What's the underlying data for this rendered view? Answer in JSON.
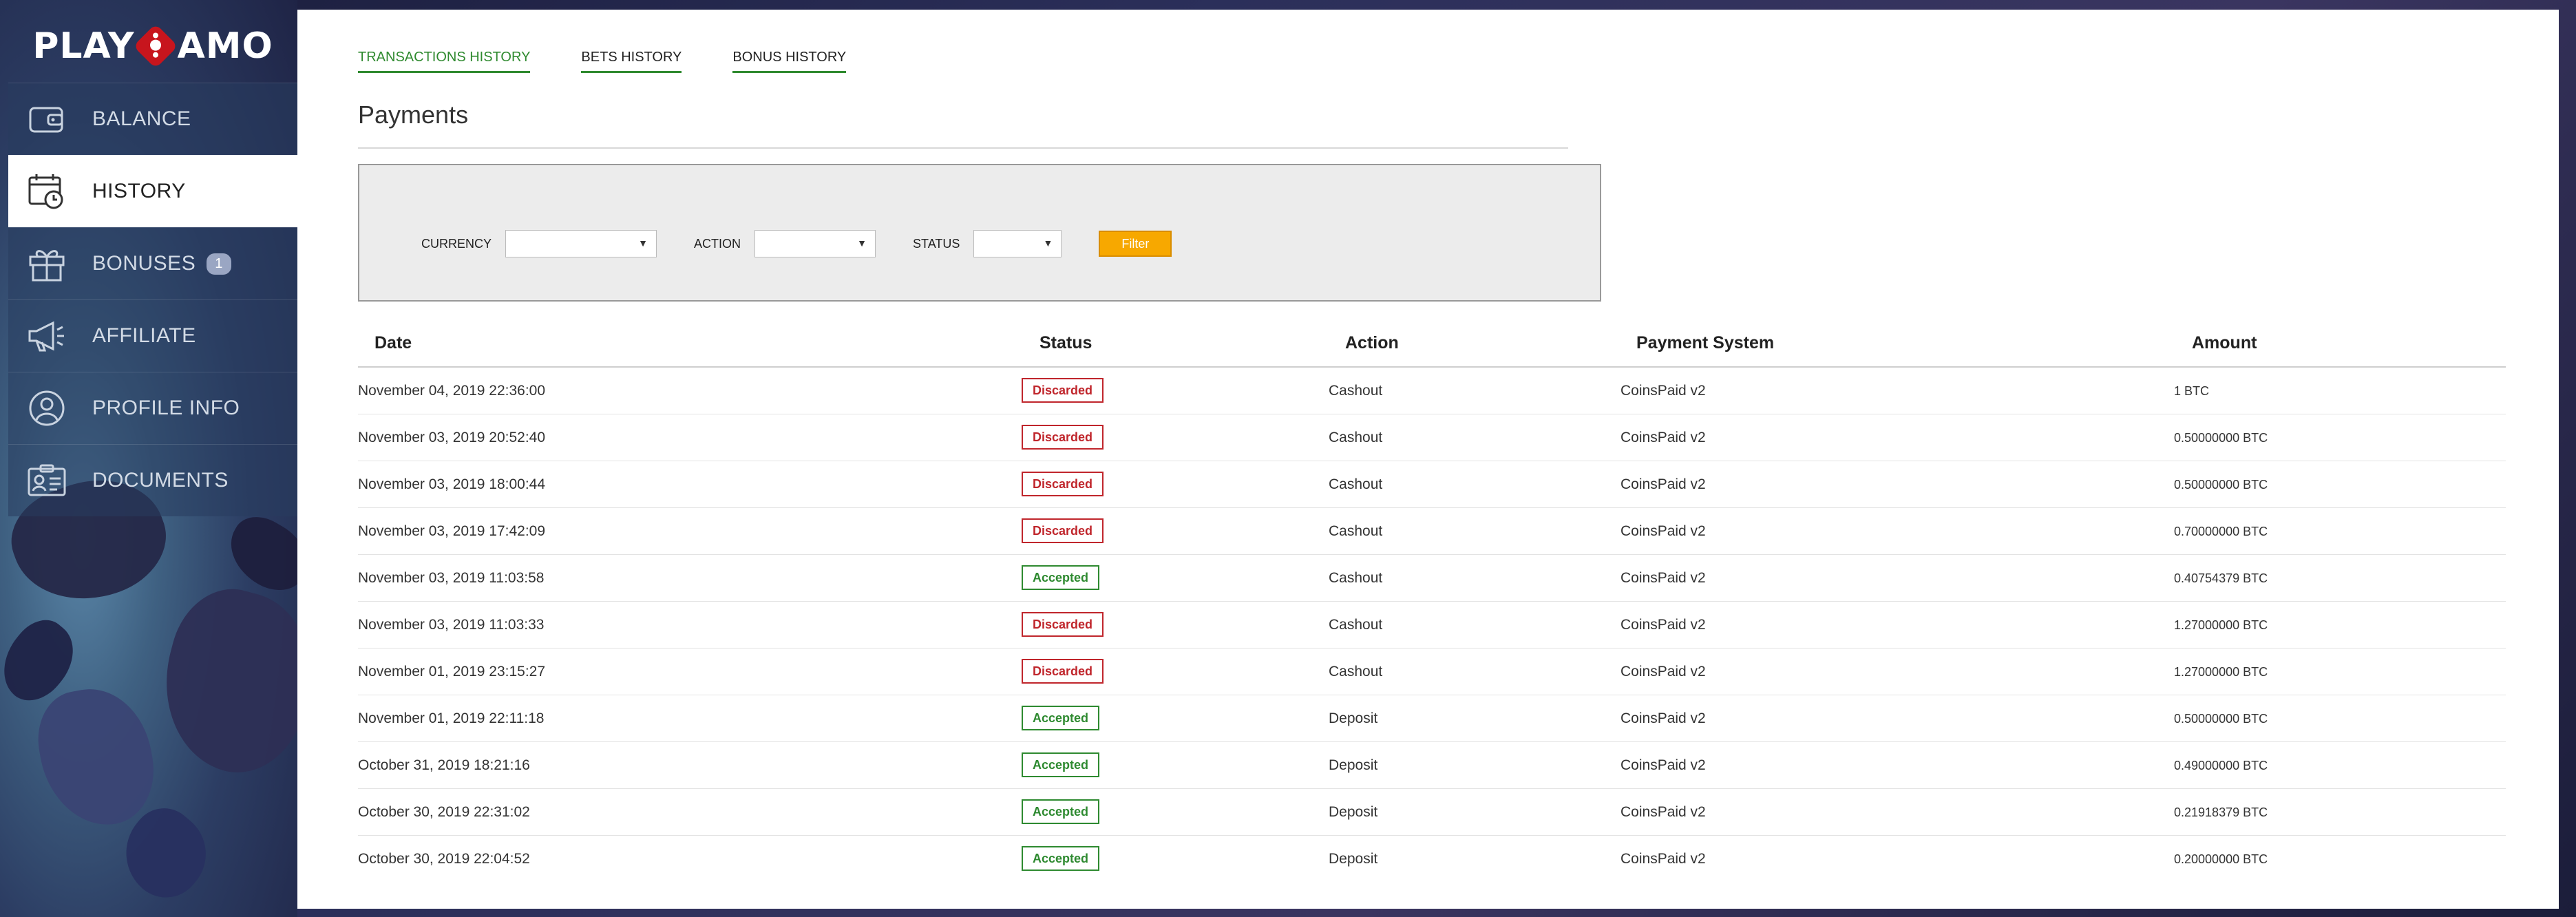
{
  "brand": {
    "left": "PLAY",
    "right": "AMO"
  },
  "sidebar": {
    "items": [
      {
        "key": "balance",
        "label": "BALANCE",
        "icon": "wallet-icon",
        "active": false
      },
      {
        "key": "history",
        "label": "HISTORY",
        "icon": "calendar-clock-icon",
        "active": true
      },
      {
        "key": "bonuses",
        "label": "BONUSES",
        "icon": "gift-icon",
        "active": false,
        "badge": "1"
      },
      {
        "key": "affiliate",
        "label": "AFFILIATE",
        "icon": "megaphone-icon",
        "active": false
      },
      {
        "key": "profile",
        "label": "PROFILE INFO",
        "icon": "user-icon",
        "active": false
      },
      {
        "key": "documents",
        "label": "DOCUMENTS",
        "icon": "id-card-icon",
        "active": false
      }
    ]
  },
  "tabs": [
    {
      "label": "TRANSACTIONS HISTORY",
      "active": true
    },
    {
      "label": "BETS HISTORY",
      "active": false
    },
    {
      "label": "BONUS HISTORY",
      "active": false
    }
  ],
  "page_title": "Payments",
  "filters": {
    "currency_label": "CURRENCY",
    "currency_value": "",
    "action_label": "ACTION",
    "action_value": "",
    "status_label": "STATUS",
    "status_value": "",
    "button_label": "Filter"
  },
  "table": {
    "headers": {
      "date": "Date",
      "status": "Status",
      "action": "Action",
      "payment_system": "Payment System",
      "amount": "Amount"
    },
    "rows": [
      {
        "date": "November 04, 2019 22:36:00",
        "status": "Discarded",
        "action": "Cashout",
        "payment_system": "CoinsPaid v2",
        "amount": "1 BTC"
      },
      {
        "date": "November 03, 2019 20:52:40",
        "status": "Discarded",
        "action": "Cashout",
        "payment_system": "CoinsPaid v2",
        "amount": "0.50000000 BTC"
      },
      {
        "date": "November 03, 2019 18:00:44",
        "status": "Discarded",
        "action": "Cashout",
        "payment_system": "CoinsPaid v2",
        "amount": "0.50000000 BTC"
      },
      {
        "date": "November 03, 2019 17:42:09",
        "status": "Discarded",
        "action": "Cashout",
        "payment_system": "CoinsPaid v2",
        "amount": "0.70000000 BTC"
      },
      {
        "date": "November 03, 2019 11:03:58",
        "status": "Accepted",
        "action": "Cashout",
        "payment_system": "CoinsPaid v2",
        "amount": "0.40754379 BTC"
      },
      {
        "date": "November 03, 2019 11:03:33",
        "status": "Discarded",
        "action": "Cashout",
        "payment_system": "CoinsPaid v2",
        "amount": "1.27000000 BTC"
      },
      {
        "date": "November 01, 2019 23:15:27",
        "status": "Discarded",
        "action": "Cashout",
        "payment_system": "CoinsPaid v2",
        "amount": "1.27000000 BTC"
      },
      {
        "date": "November 01, 2019 22:11:18",
        "status": "Accepted",
        "action": "Deposit",
        "payment_system": "CoinsPaid v2",
        "amount": "0.50000000 BTC"
      },
      {
        "date": "October 31, 2019 18:21:16",
        "status": "Accepted",
        "action": "Deposit",
        "payment_system": "CoinsPaid v2",
        "amount": "0.49000000 BTC"
      },
      {
        "date": "October 30, 2019 22:31:02",
        "status": "Accepted",
        "action": "Deposit",
        "payment_system": "CoinsPaid v2",
        "amount": "0.21918379 BTC"
      },
      {
        "date": "October 30, 2019 22:04:52",
        "status": "Accepted",
        "action": "Deposit",
        "payment_system": "CoinsPaid v2",
        "amount": "0.20000000 BTC"
      }
    ]
  },
  "colors": {
    "accent_green": "#2f8a2f",
    "discarded_red": "#c0262c",
    "filter_orange": "#f7a800"
  }
}
